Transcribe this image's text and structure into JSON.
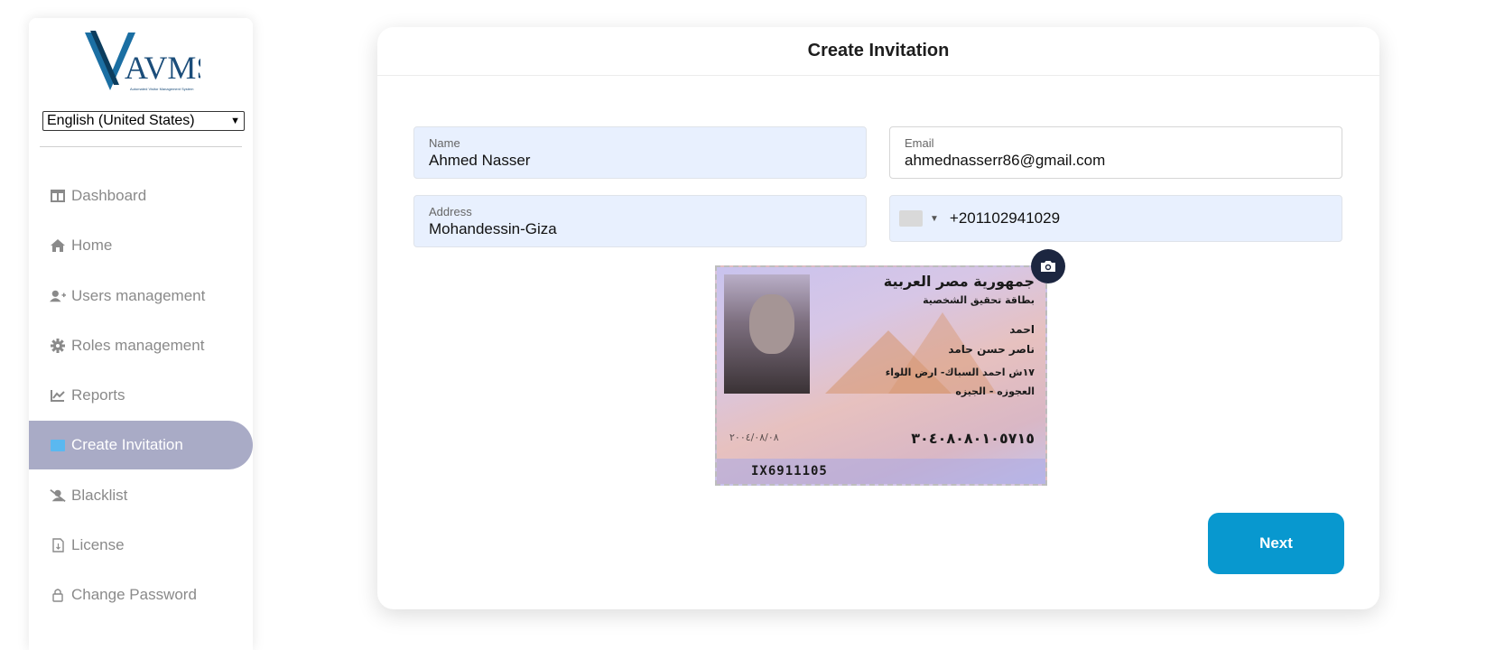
{
  "app": {
    "logo_text": "VAMS",
    "logo_tagline": "Automated Visitor Management System"
  },
  "language": {
    "selected": "English (United States)"
  },
  "sidebar": {
    "items": [
      {
        "label": "Dashboard",
        "icon": "table-icon"
      },
      {
        "label": "Home",
        "icon": "home-icon"
      },
      {
        "label": "Users management",
        "icon": "user-plus-icon"
      },
      {
        "label": "Roles management",
        "icon": "gear-icon"
      },
      {
        "label": "Reports",
        "icon": "chart-line-icon"
      },
      {
        "label": "Create Invitation",
        "icon": "envelope-icon",
        "active": true
      },
      {
        "label": "Blacklist",
        "icon": "user-slash-icon"
      },
      {
        "label": "License",
        "icon": "file-icon"
      },
      {
        "label": "Change Password",
        "icon": "lock-icon"
      }
    ]
  },
  "form": {
    "title": "Create Invitation",
    "name": {
      "label": "Name",
      "value": "Ahmed Nasser"
    },
    "email": {
      "label": "Email",
      "value": "ahmednasserr86@gmail.com"
    },
    "address": {
      "label": "Address",
      "value": "Mohandessin-Giza"
    },
    "phone": {
      "value": "+201102941029"
    },
    "id_card": {
      "header_line1": "جمهورية مصر العربية",
      "header_line2": "بطاقة تحقيق الشخصية",
      "first_name": "احمد",
      "full_name": "ناصر حسن حامد",
      "address_line1": "١٧ش احمد السباك- ارض اللواء",
      "address_line2": "العجوزه - الجيزه",
      "date": "٢٠٠٤/٠٨/٠٨",
      "national_id": "٣٠٤٠٨٠٨٠١٠٥٧١٥",
      "card_number": "IX6911105"
    },
    "next_label": "Next"
  },
  "colors": {
    "accent": "#0898cf",
    "active_nav": "#a9abc6",
    "field_bg": "#e8f0fe"
  }
}
